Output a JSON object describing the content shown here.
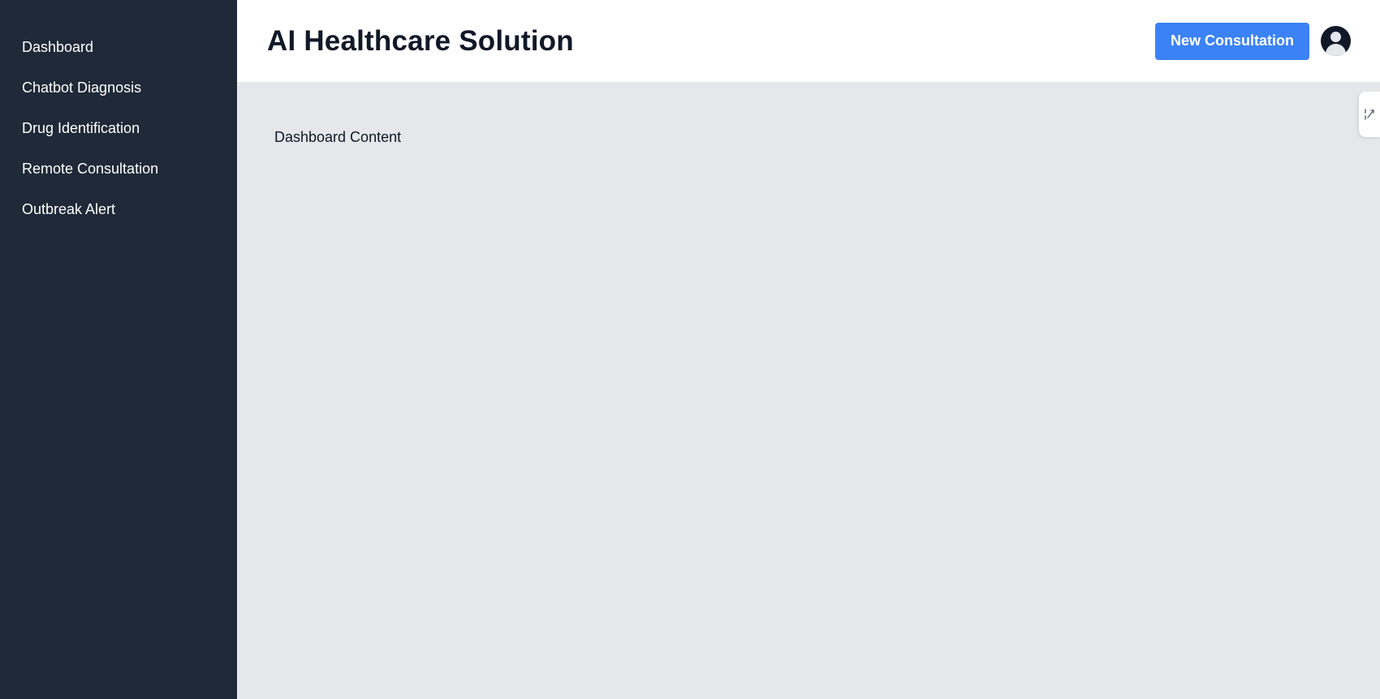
{
  "sidebar": {
    "items": [
      {
        "label": "Dashboard"
      },
      {
        "label": "Chatbot Diagnosis"
      },
      {
        "label": "Drug Identification"
      },
      {
        "label": "Remote Consultation"
      },
      {
        "label": "Outbreak Alert"
      }
    ]
  },
  "header": {
    "title": "AI Healthcare Solution",
    "new_consultation_label": "New Consultation"
  },
  "main": {
    "content_text": "Dashboard Content"
  },
  "colors": {
    "sidebar_bg": "#1f2937",
    "accent": "#3b82f6",
    "content_bg": "#e5e7eb"
  },
  "icons": {
    "avatar": "user-avatar-icon",
    "side_tab": "extension-handle-icon"
  }
}
